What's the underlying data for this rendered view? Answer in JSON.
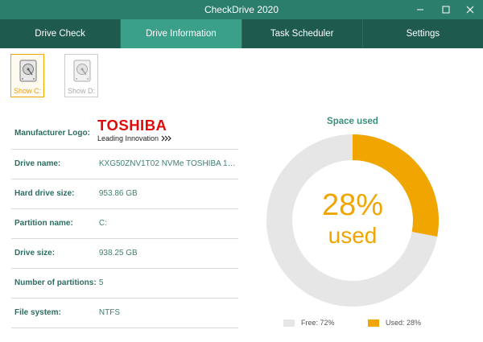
{
  "window": {
    "title": "CheckDrive 2020"
  },
  "tabs": [
    {
      "label": "Drive Check"
    },
    {
      "label": "Drive Information",
      "active": true
    },
    {
      "label": "Task Scheduler"
    },
    {
      "label": "Settings"
    }
  ],
  "drives": [
    {
      "label": "Show C:",
      "selected": true
    },
    {
      "label": "Show D:",
      "selected": false
    }
  ],
  "info": {
    "manufacturer_logo_label": "Manufacturer Logo:",
    "logo_brand": "TOSHIBA",
    "logo_tagline": "Leading Innovation",
    "rows": [
      {
        "label": "Drive name:",
        "value": "KXG50ZNV1T02 NVMe TOSHIBA 102..."
      },
      {
        "label": "Hard drive size:",
        "value": "953.86 GB"
      },
      {
        "label": "Partition name:",
        "value": "C:"
      },
      {
        "label": "Drive size:",
        "value": "938.25 GB"
      },
      {
        "label": "Number of partitions:",
        "value": "5"
      },
      {
        "label": "File system:",
        "value": "NTFS"
      }
    ]
  },
  "space": {
    "title": "Space used",
    "used_percent": 28,
    "percent_text": "28%",
    "used_word": "used",
    "legend_free": "Free: 72%",
    "legend_used": "Used: 28%",
    "colors": {
      "used": "#f0a500",
      "free": "#e6e6e6",
      "accent": "#2b7d6c"
    }
  }
}
